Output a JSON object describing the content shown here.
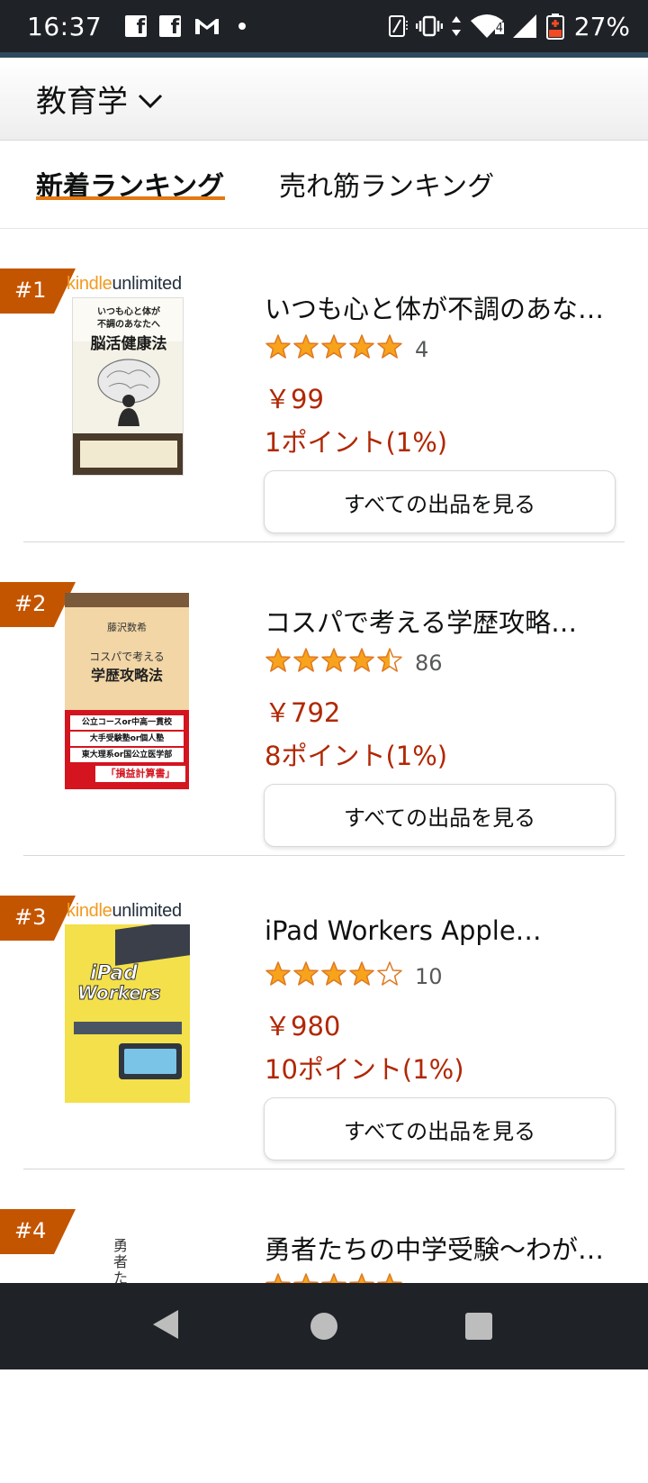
{
  "status_bar": {
    "time": "16:37",
    "battery": "27%",
    "network_badge": "4",
    "icons": [
      "facebook-icon",
      "facebook-icon",
      "gmail-icon",
      "notification-dot-icon",
      "nfc-icon",
      "vibrate-icon",
      "data-arrows-icon",
      "wifi-icon",
      "signal-icon",
      "battery-icon"
    ]
  },
  "header": {
    "category": "教育学"
  },
  "tabs": [
    {
      "label": "新着ランキング",
      "active": true
    },
    {
      "label": "売れ筋ランキング",
      "active": false
    }
  ],
  "colors": {
    "accent": "#e47911",
    "price": "#b12704",
    "star": "#f8a31c",
    "rank_badge": "#c45500"
  },
  "items": [
    {
      "rank": "#1",
      "kindle_unlimited": true,
      "ku_kindle": "kindle",
      "ku_unlimited": "unlimited",
      "title": "いつも心と体が不調のあな…",
      "rating": 5,
      "reviews": "4",
      "price": "￥99",
      "points": "1ポイント(1%)",
      "button": "すべての出品を見る",
      "cover": {
        "lines": [
          "いつも心と体が",
          "不調のあなたへ",
          "脳活健康法"
        ]
      }
    },
    {
      "rank": "#2",
      "kindle_unlimited": false,
      "title": "コスパで考える学歴攻略…",
      "rating": 4.5,
      "reviews": "86",
      "price": "￥792",
      "points": "8ポイント(1%)",
      "button": "すべての出品を見る",
      "cover": {
        "lines": [
          "藤沢数希",
          "コスパで考える",
          "学歴攻略法",
          "公立コースor中高一貫校",
          "大手受験塾or個人塾",
          "東大理系or国公立医学部",
          "「損益計算書」"
        ]
      }
    },
    {
      "rank": "#3",
      "kindle_unlimited": true,
      "ku_kindle": "kindle",
      "ku_unlimited": "unlimited",
      "title": "iPad Workers Apple…",
      "rating": 4,
      "reviews": "10",
      "price": "￥980",
      "points": "10ポイント(1%)",
      "button": "すべての出品を見る",
      "cover": {
        "lines": [
          "iPad",
          "Workers"
        ]
      }
    },
    {
      "rank": "#4",
      "kindle_unlimited": false,
      "title": "勇者たちの中学受験〜わが…",
      "rating": 5,
      "cover": {
        "lines": [
          "勇者たち"
        ]
      }
    }
  ]
}
